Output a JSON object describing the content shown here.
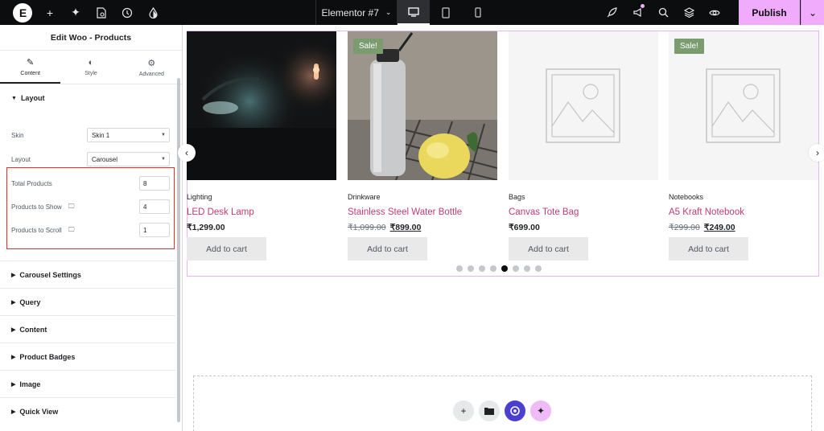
{
  "topbar": {
    "logo": "E",
    "doc_title": "Elementor #7",
    "publish_label": "Publish"
  },
  "panel": {
    "title": "Edit Woo - Products",
    "tabs": [
      {
        "label": "Content"
      },
      {
        "label": "Style"
      },
      {
        "label": "Advanced"
      }
    ],
    "layout_section": "Layout",
    "skin_label": "Skin",
    "skin_value": "Skin 1",
    "layout_label": "Layout",
    "layout_value": "Carousel",
    "total_products_label": "Total Products",
    "total_products_value": "8",
    "products_to_show_label": "Products to Show",
    "products_to_show_value": "4",
    "products_to_scroll_label": "Products to Scroll",
    "products_to_scroll_value": "1",
    "sections": [
      "Carousel Settings",
      "Query",
      "Content",
      "Product Badges",
      "Image",
      "Quick View"
    ]
  },
  "products": [
    {
      "category": "Lighting",
      "name": "LED Desk Lamp",
      "price": "₹1,299.00",
      "old_price": "",
      "sale": false,
      "cart_label": "Add to cart"
    },
    {
      "category": "Drinkware",
      "name": "Stainless Steel Water Bottle",
      "price": "₹899.00",
      "old_price": "₹1,099.00",
      "sale": true,
      "sale_label": "Sale!",
      "cart_label": "Add to cart"
    },
    {
      "category": "Bags",
      "name": "Canvas Tote Bag",
      "price": "₹699.00",
      "old_price": "",
      "sale": false,
      "cart_label": "Add to cart"
    },
    {
      "category": "Notebooks",
      "name": "A5 Kraft Notebook",
      "price": "₹249.00",
      "old_price": "₹299.00",
      "sale": true,
      "sale_label": "Sale!",
      "cart_label": "Add to cart"
    }
  ],
  "carousel": {
    "dot_count": 8,
    "active_dot": 5
  },
  "colors": {
    "accent": "#f0abfc",
    "link": "#c23a76",
    "sale_badge": "#7a9c6e",
    "highlight": "#e0322b"
  }
}
